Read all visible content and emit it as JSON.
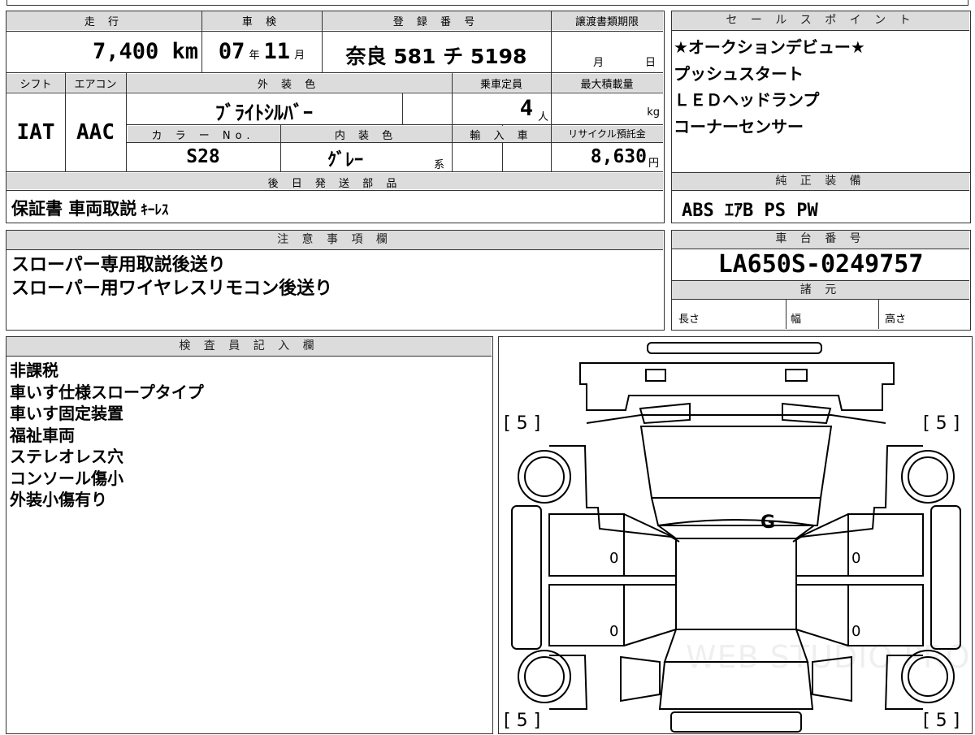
{
  "mileage": {
    "header": "走 行",
    "value": "7,400 km"
  },
  "inspection": {
    "header": "車 検",
    "year": "07",
    "year_unit": "年",
    "month": "11",
    "month_unit": "月"
  },
  "registration": {
    "header": "登 録 番 号",
    "value": "奈良 581 チ 5198"
  },
  "transfer_deadline": {
    "header": "譲渡書類期限",
    "month_unit": "月",
    "day_unit": "日"
  },
  "shift": {
    "header": "シフト",
    "value": "IAT"
  },
  "aircon": {
    "header": "エアコン",
    "value": "AAC"
  },
  "exterior_color": {
    "header": "外 装 色",
    "value": "ﾌﾞﾗｲﾄｼﾙﾊﾞｰ"
  },
  "seating": {
    "header": "乗車定員",
    "value": "4",
    "unit": "人"
  },
  "max_load": {
    "header": "最大積載量",
    "unit": "kg"
  },
  "color_no": {
    "header": "カ ラ ー No.",
    "value": "S28"
  },
  "interior_color": {
    "header": "内 装 色",
    "value": "ｸﾞﾚｰ",
    "suffix": "系"
  },
  "import": {
    "header": "輸 入 車"
  },
  "recycle": {
    "header": "リサイクル預託金",
    "value": "8,630",
    "unit": "円"
  },
  "deferred_parts": {
    "header": "後 日 発 送 部 品",
    "main": "保証書 車両取説",
    "tail": "ｷｰﾚｽ"
  },
  "notes": {
    "header": "注 意 事 項 欄",
    "lines": [
      "スローパー専用取説後送り",
      "スローパー用ワイヤレスリモコン後送り"
    ]
  },
  "sales_points": {
    "header": "セ ー ル ス ポ イ ン ト",
    "lines": [
      "★オークションデビュー★",
      "プッシュスタート",
      "ＬＥＤヘッドランプ",
      "コーナーセンサー"
    ]
  },
  "genuine_equipment": {
    "header": "純 正 装 備",
    "value": "ABS ｴｱB PS PW"
  },
  "chassis": {
    "header": "車 台 番 号",
    "value": "LA650S-0249757"
  },
  "specs": {
    "header": "諸 元",
    "length": "長さ",
    "width": "幅",
    "height": "高さ"
  },
  "inspector": {
    "header": "検 査 員 記 入 欄",
    "lines": [
      "非課税",
      "車いす仕様スロープタイプ",
      "車いす固定装置",
      "福祉車両",
      "ステレオレス穴",
      "コンソール傷小",
      "外装小傷有り"
    ]
  },
  "diagram": {
    "tires": [
      "[ 5 ]",
      "[ 5 ]",
      "[ 5 ]",
      "[ 5 ]"
    ],
    "windshield_mark": "G",
    "door_marks": [
      "0",
      "0",
      "0",
      "0"
    ],
    "watermark": "WEB STUDIO PRO"
  }
}
